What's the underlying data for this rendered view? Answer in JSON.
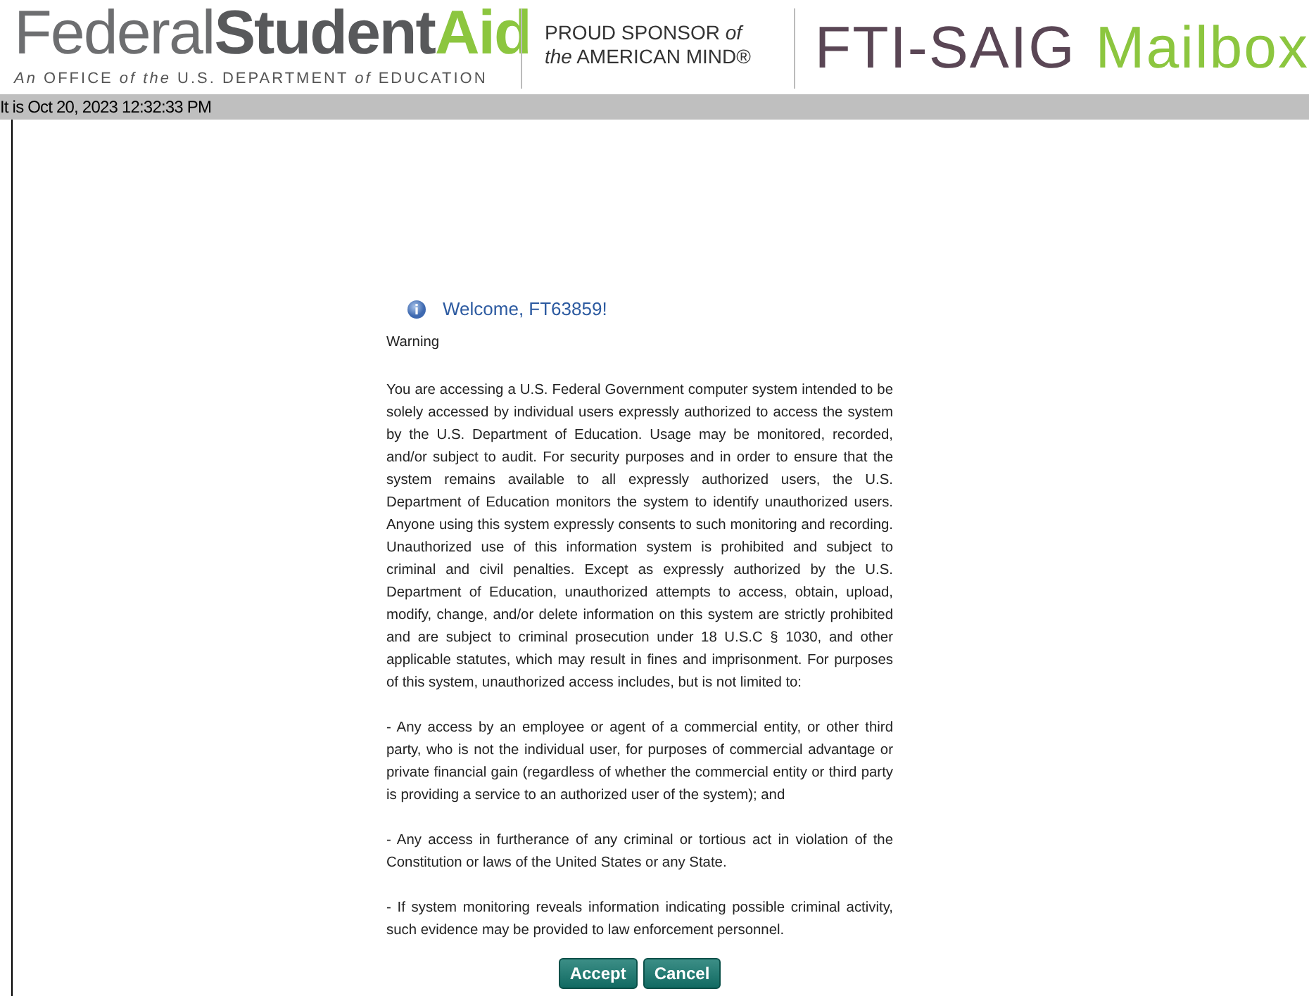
{
  "header": {
    "logo_parts": [
      "Federal",
      "Student",
      "Aid"
    ],
    "logo_tagline": "*An* OFFICE *of the* U.S. DEPARTMENT *of* EDUCATION",
    "sponsor_lines": [
      "PROUD SPONSOR *of*",
      "*the* AMERICAN MIND®"
    ],
    "title_parts": [
      "FTI-SAIG",
      "Mailbox"
    ]
  },
  "status_bar": {
    "text": "It is Oct 20, 2023 12:32:33 PM"
  },
  "welcome": "Welcome, FT63859!",
  "warning_label": "Warning",
  "paragraphs": [
    "You are accessing a U.S. Federal Government computer system intended to be solely accessed by individual users expressly authorized to access the system by the U.S. Department of Education. Usage may be monitored, recorded, and/or subject to audit. For security purposes and in order to ensure that the system remains available to all expressly authorized users, the U.S. Department of Education monitors the system to identify unauthorized users. Anyone using this system expressly consents to such monitoring and recording. Unauthorized use of this information system is prohibited and subject to criminal and civil penalties. Except as expressly authorized by the U.S. Department of Education, unauthorized attempts to access, obtain, upload, modify, change, and/or delete information on this system are strictly prohibited and are subject to criminal prosecution under 18 U.S.C § 1030, and other applicable statutes, which may result in fines and imprisonment. For purposes of this system, unauthorized access includes, but is not limited to:",
    "- Any access by an employee or agent of a commercial entity, or other third party, who is not the individual user, for purposes of commercial advantage or private financial gain (regardless of whether the commercial entity or third party is providing a service to an authorized user of the system); and",
    "- Any access in furtherance of any criminal or tortious act in violation of the Constitution or laws of the United States or any State.",
    "- If system monitoring reveals information indicating possible criminal activity, such evidence may be provided to law enforcement personnel."
  ],
  "buttons": [
    "Accept",
    "Cancel"
  ]
}
